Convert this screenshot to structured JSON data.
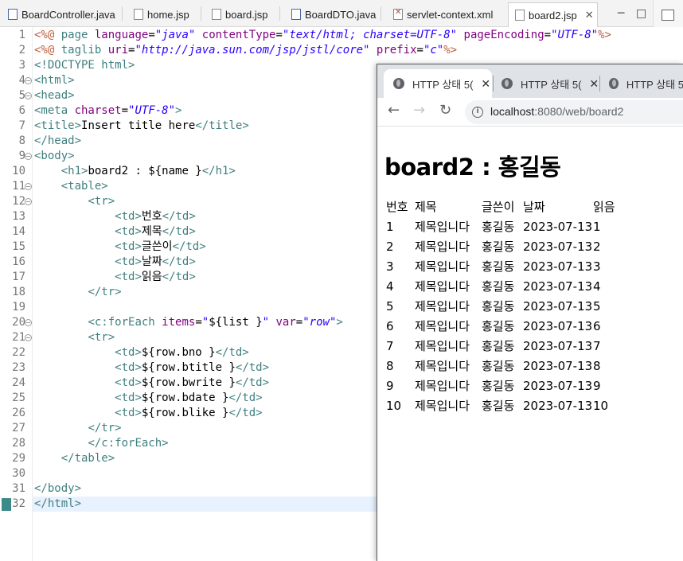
{
  "editor_tabs": [
    {
      "label": "BoardController.java",
      "type": "java"
    },
    {
      "label": "home.jsp",
      "type": "jsp"
    },
    {
      "label": "board.jsp",
      "type": "jsp"
    },
    {
      "label": "BoardDTO.java",
      "type": "java"
    },
    {
      "label": "servlet-context.xml",
      "type": "xml"
    },
    {
      "label": "board2.jsp",
      "type": "jsp",
      "active": true
    }
  ],
  "window_controls": {
    "minimize": "─",
    "maximize": "□",
    "close_tab": "✕"
  },
  "code_lines": [
    {
      "n": "1",
      "segs": [
        [
          "d",
          "<%@ "
        ],
        [
          "t",
          "page "
        ],
        [
          "a",
          "language"
        ],
        [
          "x",
          "="
        ],
        [
          "s",
          "\"java\""
        ],
        [
          "x",
          " "
        ],
        [
          "a",
          "contentType"
        ],
        [
          "x",
          "="
        ],
        [
          "s",
          "\"text/html; charset=UTF-8\""
        ],
        [
          "x",
          " "
        ],
        [
          "a",
          "pageEncoding"
        ],
        [
          "x",
          "="
        ],
        [
          "s",
          "\"UTF-8\""
        ],
        [
          "d",
          "%>"
        ]
      ]
    },
    {
      "n": "2",
      "segs": [
        [
          "d",
          "<%@ "
        ],
        [
          "t",
          "taglib "
        ],
        [
          "a",
          "uri"
        ],
        [
          "x",
          "="
        ],
        [
          "s",
          "\"http://java.sun.com/jsp/jstl/core\""
        ],
        [
          "x",
          " "
        ],
        [
          "a",
          "prefix"
        ],
        [
          "x",
          "="
        ],
        [
          "s",
          "\"c\""
        ],
        [
          "d",
          "%>"
        ]
      ]
    },
    {
      "n": "3",
      "segs": [
        [
          "t",
          "<!DOCTYPE html>"
        ]
      ]
    },
    {
      "n": "4",
      "fold": true,
      "segs": [
        [
          "t",
          "<html>"
        ]
      ]
    },
    {
      "n": "5",
      "fold": true,
      "segs": [
        [
          "t",
          "<head>"
        ]
      ]
    },
    {
      "n": "6",
      "segs": [
        [
          "t",
          "<meta "
        ],
        [
          "a",
          "charset"
        ],
        [
          "x",
          "="
        ],
        [
          "s",
          "\"UTF-8\""
        ],
        [
          "t",
          ">"
        ]
      ]
    },
    {
      "n": "7",
      "segs": [
        [
          "t",
          "<title>"
        ],
        [
          "x",
          "Insert title here"
        ],
        [
          "t",
          "</title>"
        ]
      ]
    },
    {
      "n": "8",
      "segs": [
        [
          "t",
          "</head>"
        ]
      ]
    },
    {
      "n": "9",
      "fold": true,
      "segs": [
        [
          "t",
          "<body>"
        ]
      ]
    },
    {
      "n": "10",
      "segs": [
        [
          "x",
          "    "
        ],
        [
          "t",
          "<h1>"
        ],
        [
          "x",
          "board2 : ${name }"
        ],
        [
          "t",
          "</h1>"
        ]
      ]
    },
    {
      "n": "11",
      "fold": true,
      "segs": [
        [
          "x",
          "    "
        ],
        [
          "t",
          "<table>"
        ]
      ]
    },
    {
      "n": "12",
      "fold": true,
      "segs": [
        [
          "x",
          "        "
        ],
        [
          "t",
          "<tr>"
        ]
      ]
    },
    {
      "n": "13",
      "segs": [
        [
          "x",
          "            "
        ],
        [
          "t",
          "<td>"
        ],
        [
          "x",
          "번호"
        ],
        [
          "t",
          "</td>"
        ]
      ]
    },
    {
      "n": "14",
      "segs": [
        [
          "x",
          "            "
        ],
        [
          "t",
          "<td>"
        ],
        [
          "x",
          "제목"
        ],
        [
          "t",
          "</td>"
        ]
      ]
    },
    {
      "n": "15",
      "segs": [
        [
          "x",
          "            "
        ],
        [
          "t",
          "<td>"
        ],
        [
          "x",
          "글쓴이"
        ],
        [
          "t",
          "</td>"
        ]
      ]
    },
    {
      "n": "16",
      "segs": [
        [
          "x",
          "            "
        ],
        [
          "t",
          "<td>"
        ],
        [
          "x",
          "날짜"
        ],
        [
          "t",
          "</td>"
        ]
      ]
    },
    {
      "n": "17",
      "segs": [
        [
          "x",
          "            "
        ],
        [
          "t",
          "<td>"
        ],
        [
          "x",
          "읽음"
        ],
        [
          "t",
          "</td>"
        ]
      ]
    },
    {
      "n": "18",
      "segs": [
        [
          "x",
          "        "
        ],
        [
          "t",
          "</tr>"
        ]
      ]
    },
    {
      "n": "19",
      "segs": []
    },
    {
      "n": "20",
      "fold": true,
      "segs": [
        [
          "x",
          "        "
        ],
        [
          "t",
          "<c:forEach "
        ],
        [
          "a",
          "items"
        ],
        [
          "x",
          "="
        ],
        [
          "s",
          "\""
        ],
        [
          "x",
          "${list }"
        ],
        [
          "s",
          "\""
        ],
        [
          "x",
          " "
        ],
        [
          "a",
          "var"
        ],
        [
          "x",
          "="
        ],
        [
          "s",
          "\"row\""
        ],
        [
          "t",
          ">"
        ]
      ]
    },
    {
      "n": "21",
      "fold": true,
      "segs": [
        [
          "x",
          "        "
        ],
        [
          "t",
          "<tr>"
        ]
      ]
    },
    {
      "n": "22",
      "segs": [
        [
          "x",
          "            "
        ],
        [
          "t",
          "<td>"
        ],
        [
          "x",
          "${row.bno }"
        ],
        [
          "t",
          "</td>"
        ]
      ]
    },
    {
      "n": "23",
      "segs": [
        [
          "x",
          "            "
        ],
        [
          "t",
          "<td>"
        ],
        [
          "x",
          "${row.btitle }"
        ],
        [
          "t",
          "</td>"
        ]
      ]
    },
    {
      "n": "24",
      "segs": [
        [
          "x",
          "            "
        ],
        [
          "t",
          "<td>"
        ],
        [
          "x",
          "${row.bwrite }"
        ],
        [
          "t",
          "</td>"
        ]
      ]
    },
    {
      "n": "25",
      "segs": [
        [
          "x",
          "            "
        ],
        [
          "t",
          "<td>"
        ],
        [
          "x",
          "${row.bdate }"
        ],
        [
          "t",
          "</td>"
        ]
      ]
    },
    {
      "n": "26",
      "segs": [
        [
          "x",
          "            "
        ],
        [
          "t",
          "<td>"
        ],
        [
          "x",
          "${row.blike }"
        ],
        [
          "t",
          "</td>"
        ]
      ]
    },
    {
      "n": "27",
      "segs": [
        [
          "x",
          "        "
        ],
        [
          "t",
          "</tr>"
        ]
      ]
    },
    {
      "n": "28",
      "segs": [
        [
          "x",
          "        "
        ],
        [
          "t",
          "</c:forEach>"
        ]
      ]
    },
    {
      "n": "29",
      "segs": [
        [
          "x",
          "    "
        ],
        [
          "t",
          "</table>"
        ]
      ]
    },
    {
      "n": "30",
      "segs": []
    },
    {
      "n": "31",
      "segs": [
        [
          "t",
          "</body>"
        ]
      ]
    },
    {
      "n": "32",
      "current": true,
      "segs": [
        [
          "t",
          "</html>"
        ]
      ]
    }
  ],
  "browser": {
    "tabs": [
      {
        "label": "HTTP 상태 5(",
        "active": true
      },
      {
        "label": "HTTP 상태 5(",
        "active": false
      },
      {
        "label": "HTTP 상태 5",
        "active": false
      }
    ],
    "tab_close": "✕",
    "nav": {
      "back": "←",
      "forward": "→",
      "reload": "↻",
      "info": "i"
    },
    "url_host": "localhost",
    "url_path": ":8080/web/board2",
    "page": {
      "heading": "board2 : 홍길동",
      "headers": [
        "번호",
        "제목",
        "글쓴이",
        "날짜",
        "읽음"
      ],
      "rows": [
        [
          "1",
          "제목입니다",
          "홍길동",
          "2023-07-13",
          "1"
        ],
        [
          "2",
          "제목입니다",
          "홍길동",
          "2023-07-13",
          "2"
        ],
        [
          "3",
          "제목입니다",
          "홍길동",
          "2023-07-13",
          "3"
        ],
        [
          "4",
          "제목입니다",
          "홍길동",
          "2023-07-13",
          "4"
        ],
        [
          "5",
          "제목입니다",
          "홍길동",
          "2023-07-13",
          "5"
        ],
        [
          "6",
          "제목입니다",
          "홍길동",
          "2023-07-13",
          "6"
        ],
        [
          "7",
          "제목입니다",
          "홍길동",
          "2023-07-13",
          "7"
        ],
        [
          "8",
          "제목입니다",
          "홍길동",
          "2023-07-13",
          "8"
        ],
        [
          "9",
          "제목입니다",
          "홍길동",
          "2023-07-13",
          "9"
        ],
        [
          "10",
          "제목입니다",
          "홍길동",
          "2023-07-13",
          "10"
        ]
      ]
    }
  },
  "colors": {
    "directive": "#bf5f3f",
    "tag": "#3f7f7f",
    "attribute": "#7f007f",
    "string": "#2a00ff",
    "current_line": "#e8f2fe"
  }
}
